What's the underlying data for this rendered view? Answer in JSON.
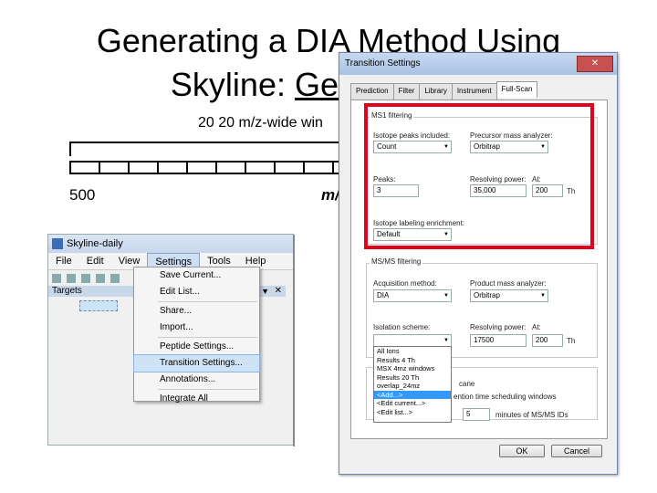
{
  "slide": {
    "title_line1": "Generating a DIA Method Using",
    "title_line2_plain": "Skyline: ",
    "title_line2_underlined": "Generat",
    "mz_note": "20  20 m/z-wide win",
    "tick_start": "500",
    "tick_end": "m/"
  },
  "skyline": {
    "title": "Skyline-daily",
    "menu": [
      "File",
      "Edit",
      "View",
      "Settings",
      "Tools",
      "Help"
    ],
    "targets_label": "Targets",
    "pin": "▼",
    "close": "✕",
    "settings_menu": [
      "Save Current...",
      "Edit List...",
      "Share...",
      "Import...",
      "Peptide Settings...",
      "Transition Settings...",
      "Annotations...",
      "Integrate All"
    ]
  },
  "dialog": {
    "title": "Transition Settings",
    "close": "✕",
    "tabs": [
      "Prediction",
      "Filter",
      "Library",
      "Instrument",
      "Full-Scan"
    ],
    "ms1": {
      "group": "MS1 filtering",
      "isotope_label": "Isotope peaks included:",
      "isotope_value": "Count",
      "analyzer_label": "Precursor mass analyzer:",
      "analyzer_value": "Orbitrap",
      "peaks_label": "Peaks:",
      "peaks_value": "3",
      "resolving_label": "Resolving power:",
      "resolving_value": "35,000",
      "at_label": "At:",
      "at_value": "200",
      "th": "Th",
      "enrichment_label": "Isotope labeling enrichment:",
      "enrichment_value": "Default"
    },
    "msms": {
      "group": "MS/MS filtering",
      "acq_label": "Acquisition method:",
      "acq_value": "DIA",
      "prod_label": "Product mass analyzer:",
      "prod_value": "Orbitrap",
      "iso_label": "Isolation scheme:",
      "iso_value": "",
      "res_label": "Resolving power:",
      "res_value": "17500",
      "at_label": "At:",
      "at_value": "200",
      "th": "Th",
      "options": [
        "All Ions",
        "Results 4 Th",
        "MSX 4mz windows",
        "Results 20 Th",
        "overlap_24mz",
        "<Add...>",
        "<Edit current...>",
        "<Edit list...>"
      ]
    },
    "retention": {
      "line1": "cane",
      "line2": "ention time scheduling windows",
      "within_value": "5",
      "minutes_label": "minutes of MS/MS IDs"
    },
    "ok": "OK",
    "cancel": "Cancel"
  }
}
